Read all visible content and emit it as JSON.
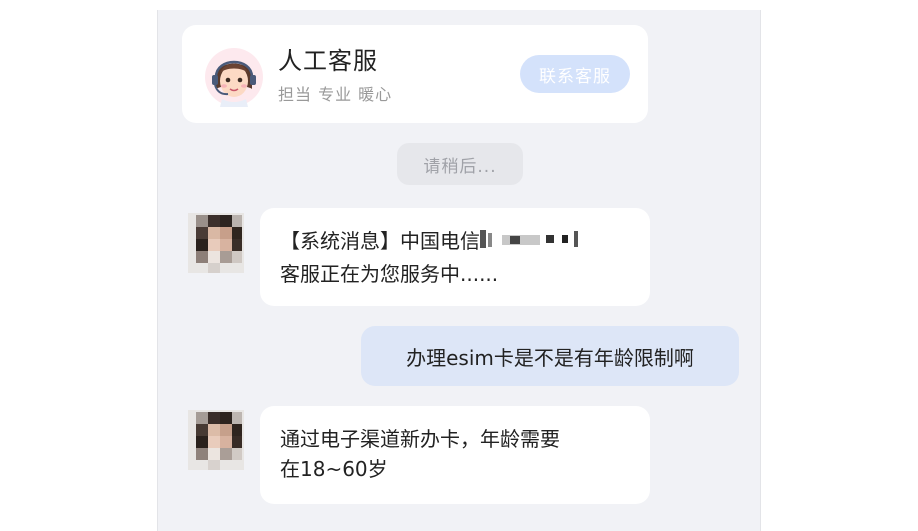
{
  "header": {
    "title": "人工客服",
    "subtitle": "担当 专业 暖心",
    "contact_label": "联系客服"
  },
  "status": {
    "wait_text": "请稍后..."
  },
  "messages": [
    {
      "from": "agent",
      "line1_prefix": "【系统消息】中国电信",
      "line2": "客服正在为您服务中......"
    },
    {
      "from": "user",
      "text": "办理esim卡是不是有年龄限制啊"
    },
    {
      "from": "agent",
      "line1": "通过电子渠道新办卡，年龄需要",
      "line2": "在18~60岁"
    }
  ],
  "colors": {
    "panel_bg": "#f1f2f6",
    "bubble_agent": "#ffffff",
    "bubble_user": "#dde6f7",
    "contact_btn": "#d4e2fb"
  },
  "icons": [
    "agent-headset-avatar-icon",
    "blurred-agent-avatar"
  ]
}
